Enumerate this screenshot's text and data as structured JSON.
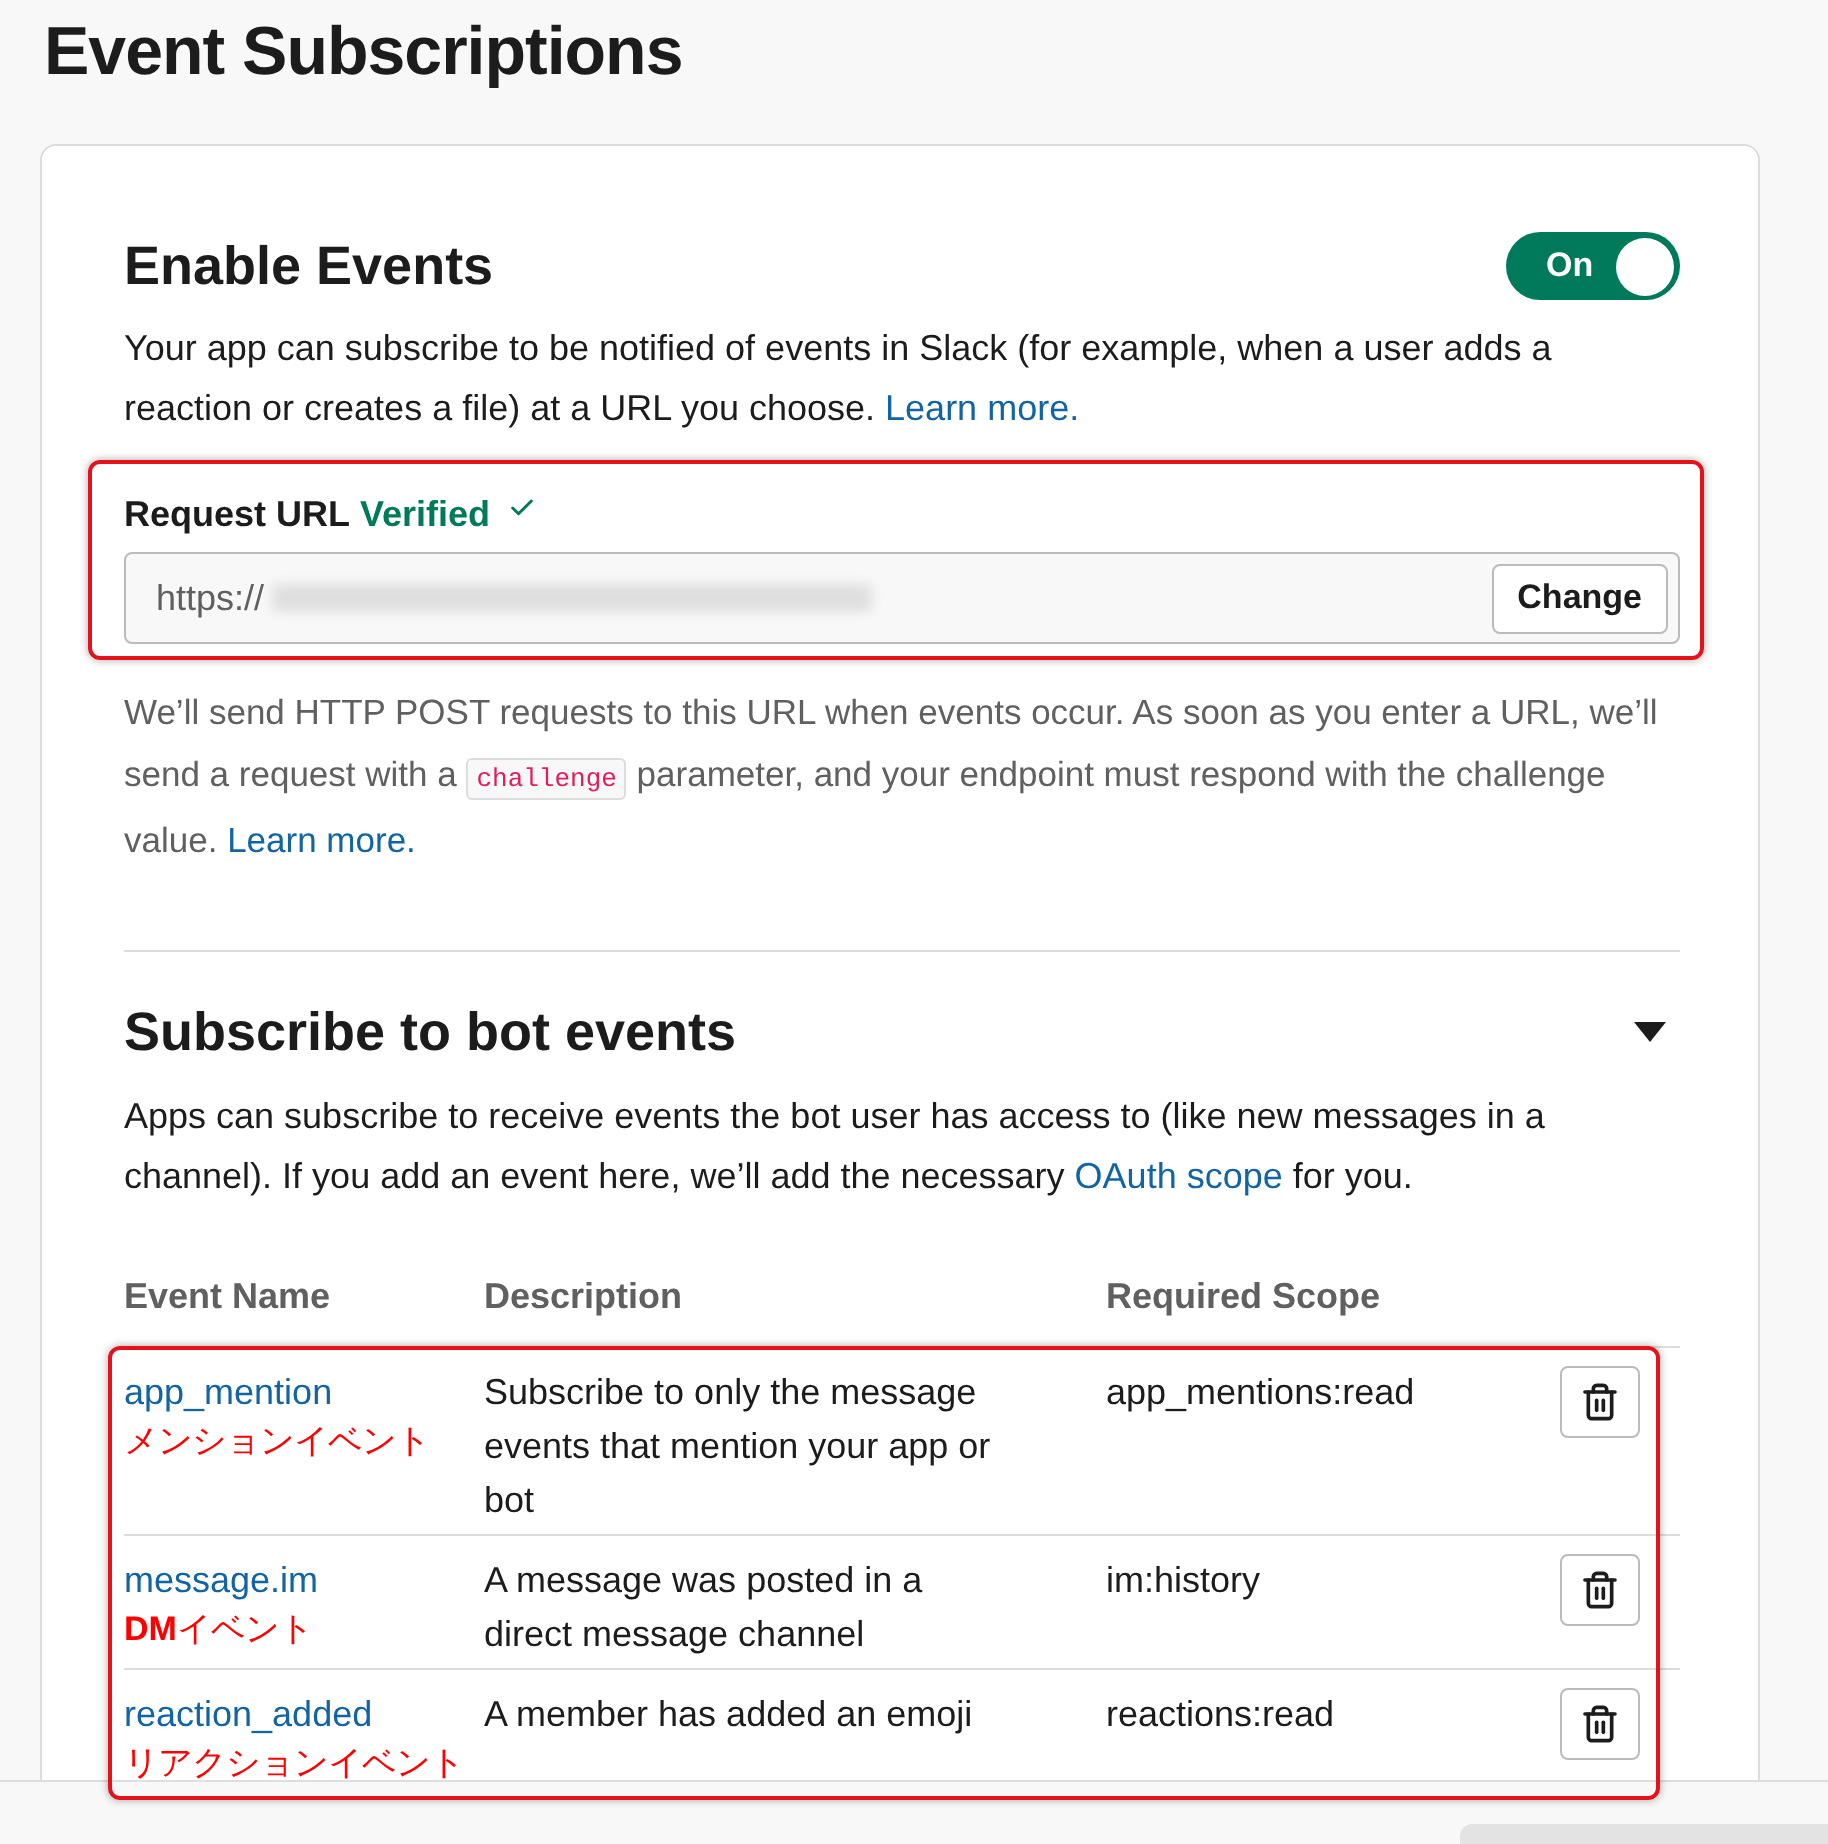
{
  "page": {
    "title": "Event Subscriptions"
  },
  "enable_events": {
    "title": "Enable Events",
    "toggle": {
      "label": "On",
      "on": true
    },
    "description": [
      {
        "kind": "text",
        "text": "Your app can subscribe to be notified of events in Slack (for example, when a user adds a reaction or creates a file) at a URL you choose. "
      },
      {
        "kind": "link",
        "text": "Learn more."
      }
    ]
  },
  "request_url": {
    "label": "Request URL",
    "status": "Verified",
    "verified": true,
    "highlighted": true,
    "value": "https://",
    "blurred": true,
    "button": "Change"
  },
  "help_text": [
    {
      "kind": "text",
      "text": "We’ll send HTTP POST requests to this URL when events occur. As soon as you enter a URL, we’ll send a request with a "
    },
    {
      "kind": "code",
      "text": "challenge"
    },
    {
      "kind": "text",
      "text": " parameter, and your endpoint must respond with the challenge value. "
    },
    {
      "kind": "link",
      "text": "Learn more."
    }
  ],
  "bot_events": {
    "title": "Subscribe to bot events",
    "expanded": true,
    "description": [
      {
        "kind": "text",
        "text": "Apps can subscribe to receive events the bot user has access to (like new messages in a channel). If you add an event here, we’ll add the necessary "
      },
      {
        "kind": "link",
        "text": "OAuth scope"
      },
      {
        "kind": "text",
        "text": " for you."
      }
    ],
    "table": {
      "columns": [
        "Event Name",
        "Description",
        "Required Scope"
      ],
      "highlighted": true,
      "rows": [
        {
          "event": "app_mention",
          "description": "Subscribe to only the message events that mention your app or bot",
          "scope": "app_mentions:read",
          "annotation": "メンションイベント"
        },
        {
          "event": "message.im",
          "description": "A message was posted in a direct message channel",
          "scope": "im:history",
          "annotation": "**DM**イベント"
        },
        {
          "event": "reaction_added",
          "description": "A member has added an emoji",
          "scope": "reactions:read",
          "annotation": "リアクションイベント"
        }
      ]
    }
  }
}
